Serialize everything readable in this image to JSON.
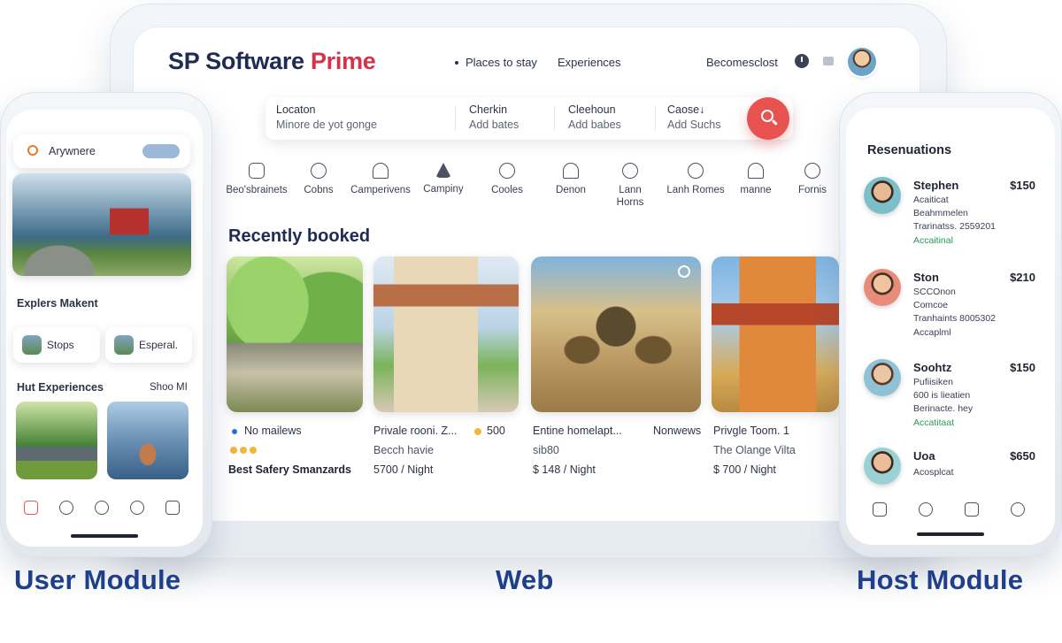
{
  "web": {
    "brand_main": "SP Software ",
    "brand_accent": "Prime",
    "nav": {
      "places": "Places to stay",
      "experiences": "Experiences",
      "user": "Becomesclost"
    },
    "search": {
      "location_label": "Locaton",
      "location_value": "Minore de yot gonge",
      "checkin_label": "Cherkin",
      "checkin_value": "Add bates",
      "checkout_label": "Cleehoun",
      "checkout_value": "Add babes",
      "guests_label": "Caose↓",
      "guests_value": "Add Suchs"
    },
    "categories": [
      {
        "label": "Beo'sbrainets",
        "icon": "bed-icon"
      },
      {
        "label": "Cobns",
        "icon": "cabin-icon"
      },
      {
        "label": "Camperivens",
        "icon": "camper-icon"
      },
      {
        "label": "Campiny",
        "icon": "tent-icon"
      },
      {
        "label": "Cooles",
        "icon": "castle-icon"
      },
      {
        "label": "Denon",
        "icon": "door-icon"
      },
      {
        "label": "Lann\nHorns",
        "icon": "lighthouse-icon"
      },
      {
        "label": "Lanh Romes",
        "icon": "globe-icon"
      },
      {
        "label": "manne",
        "icon": "boat-icon"
      },
      {
        "label": "Fornis",
        "icon": "pin-icon"
      }
    ],
    "section_title": "Recently booked",
    "listings": [
      {
        "line1": "No mailews",
        "line3": "Best Safery Smanzards",
        "price": ""
      },
      {
        "line1": "Privale rooni. Z...",
        "rating": "500",
        "line2": "Becch havie",
        "price": "5700 / Night"
      },
      {
        "line1": "Entine homelapt...",
        "tag": "Nonwews",
        "line2": "sib80",
        "price": "$ 148 / Night"
      },
      {
        "line1": "Privgle Toom. 1",
        "line2": "The Olange Vilta",
        "price": "$ 700 / Night"
      }
    ]
  },
  "user_module": {
    "search_text": "Arywnere",
    "section1": "Explers Makent",
    "chips": [
      "Stops",
      "Esperal."
    ],
    "section2": "Hut Experiences",
    "see_more": "Shoo MI"
  },
  "host_module": {
    "title": "Resenuations",
    "reservations": [
      {
        "name": "Stephen",
        "price": "$150",
        "lines": [
          "Acaiticat",
          "Beahmmelen",
          "Trarinatss. 2559201"
        ],
        "status": "Accaitinal"
      },
      {
        "name": "Ston",
        "price": "$210",
        "lines": [
          "SCCOnon",
          "Comcoe",
          "Tranhaints 8005302"
        ],
        "status": "Accaplml"
      },
      {
        "name": "Soohtz",
        "price": "$150",
        "lines": [
          "Pufiisiken",
          "600 is lieatien",
          "Berinacte. hey"
        ],
        "status": "Accatitaat"
      },
      {
        "name": "Uoa",
        "price": "$650",
        "lines": [
          "Acosplcat"
        ],
        "status": ""
      }
    ]
  },
  "labels": {
    "user": "User Module",
    "web": "Web",
    "host": "Host Module"
  },
  "colors": {
    "brand_navy": "#1e2b55",
    "brand_red": "#d2344a",
    "search_button": "#e9534f",
    "label_blue": "#1e3f8c",
    "status_green": "#2a9a54"
  }
}
